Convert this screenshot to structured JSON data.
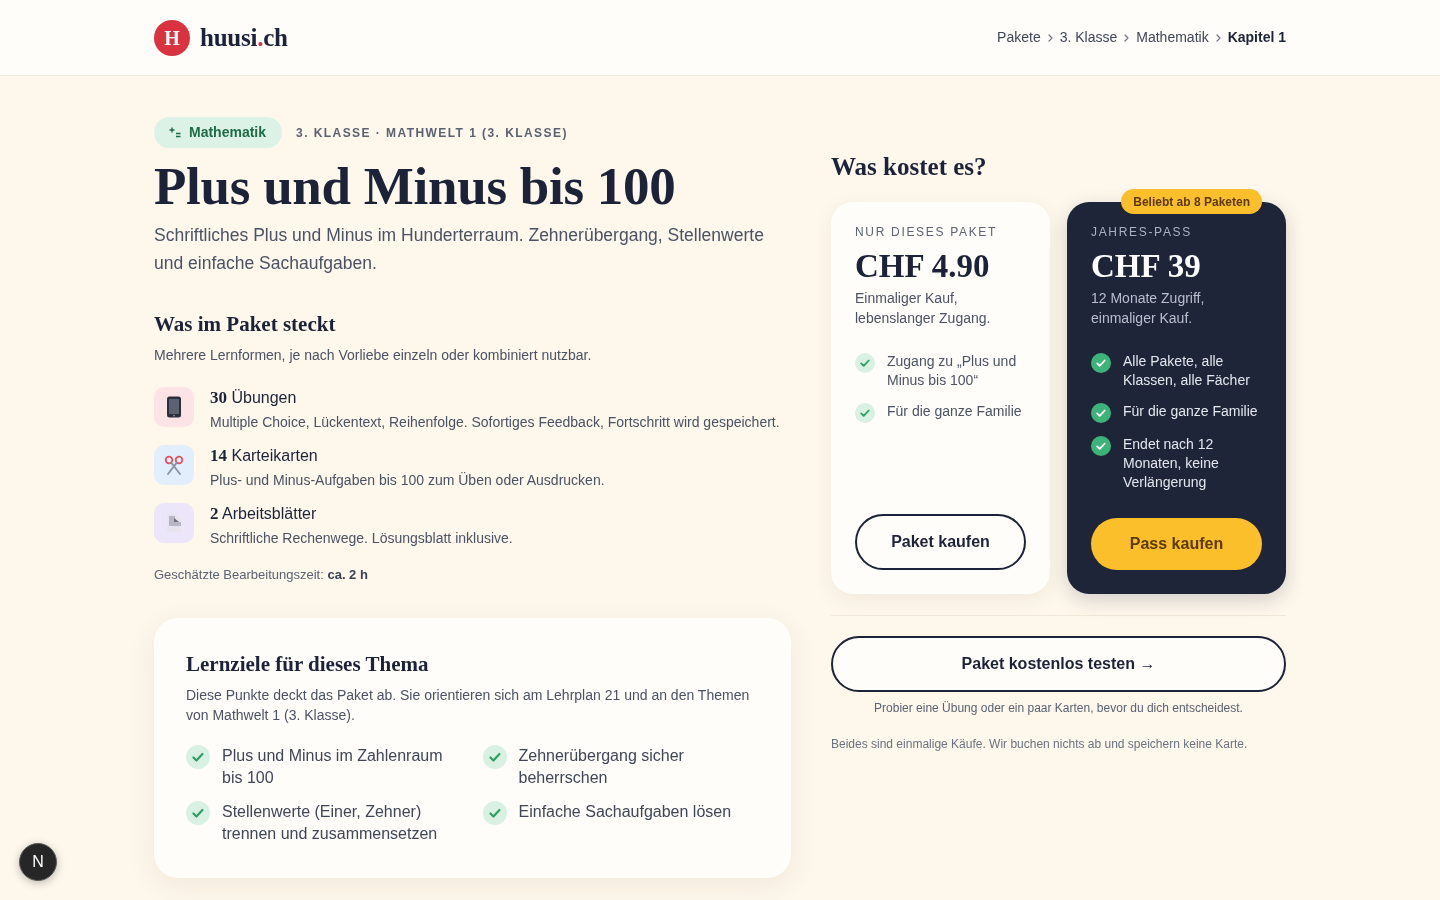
{
  "header": {
    "logo": {
      "mark": "H",
      "name": "huusi",
      "dot": ".",
      "tld": "ch"
    },
    "breadcrumb": [
      {
        "label": "Pakete",
        "current": false
      },
      {
        "label": "3. Klasse",
        "current": false
      },
      {
        "label": "Mathematik",
        "current": false
      },
      {
        "label": "Kapitel 1",
        "current": true
      }
    ]
  },
  "package": {
    "subject": "Mathematik",
    "context": "3. KLASSE · MATHWELT 1 (3. KLASSE)",
    "title": "Plus und Minus bis 100",
    "description": "Schriftliches Plus und Minus im Hunderterraum. Zehnerübergang, Stellenwerte und einfache Sachaufgaben.",
    "contents": {
      "heading": "Was im Paket steckt",
      "intro": "Mehrere Lernformen, je nach Vorliebe einzeln oder kombiniert nutzbar.",
      "items": [
        {
          "kind": "exercises",
          "color": "#fce4e6",
          "count": "30",
          "label": "Übungen",
          "description": "Multiple Choice, Lückentext, Reihenfolge. Sofortiges Feedback, Fortschritt wird gespeichert."
        },
        {
          "kind": "flashcards",
          "color": "#e2eefb",
          "count": "14",
          "label": "Karteikarten",
          "description": "Plus- und Minus-Aufgaben bis 100 zum Üben oder Ausdrucken."
        },
        {
          "kind": "worksheets",
          "color": "#ece6fa",
          "count": "2",
          "label": "Arbeitsblätter",
          "description": "Schriftliche Rechenwege. Lösungsblatt inklusive."
        }
      ]
    },
    "estimate": "Geschätzte Bearbeitungszeit: **ca. 2 h**"
  },
  "goals": {
    "heading": "Lernziele für dieses Thema",
    "description": "Diese Punkte deckt das Paket ab. Sie orientieren sich am Lehrplan 21 und an den Themen von Mathwelt 1 (3. Klasse).",
    "items": [
      "Plus und Minus im Zahlenraum bis 100",
      "Zehnerübergang sicher beherrschen",
      "Stellenwerte (Einer, Zehner) trennen und zusammensetzen",
      "Einfache Sachaufgaben lösen"
    ]
  },
  "pricing": {
    "heading": "Was kostet es?",
    "plans": [
      {
        "kind": "single",
        "label": "NUR DIESES PAKET",
        "price": "CHF 4.90",
        "note": "Einmaliger Kauf, lebenslanger Zugang.",
        "features": [
          "Zugang zu „Plus und Minus bis 100“",
          "Für die ganze Familie"
        ],
        "button": "Paket kaufen"
      },
      {
        "kind": "pass",
        "badge": "Beliebt ab 8 Paketen",
        "label": "JAHRES-PASS",
        "price": "CHF 39",
        "note": "12 Monate Zugriff, einmaliger Kauf.",
        "features": [
          "Alle Pakete, alle Klassen, alle Fächer",
          "Für die ganze Familie",
          "Endet nach 12 Monaten, keine Verlängerung"
        ],
        "button": "Pass kaufen"
      }
    ],
    "trial_button": "Paket kostenlos testen →",
    "trial_note": "Probier eine Übung oder ein paar Karten, bevor du dich entscheidest.",
    "footnote": "Beides sind einmalige Käufe. Wir buchen nichts ab und speichern keine Karte."
  },
  "dev_indicator": {
    "letter": "N"
  }
}
